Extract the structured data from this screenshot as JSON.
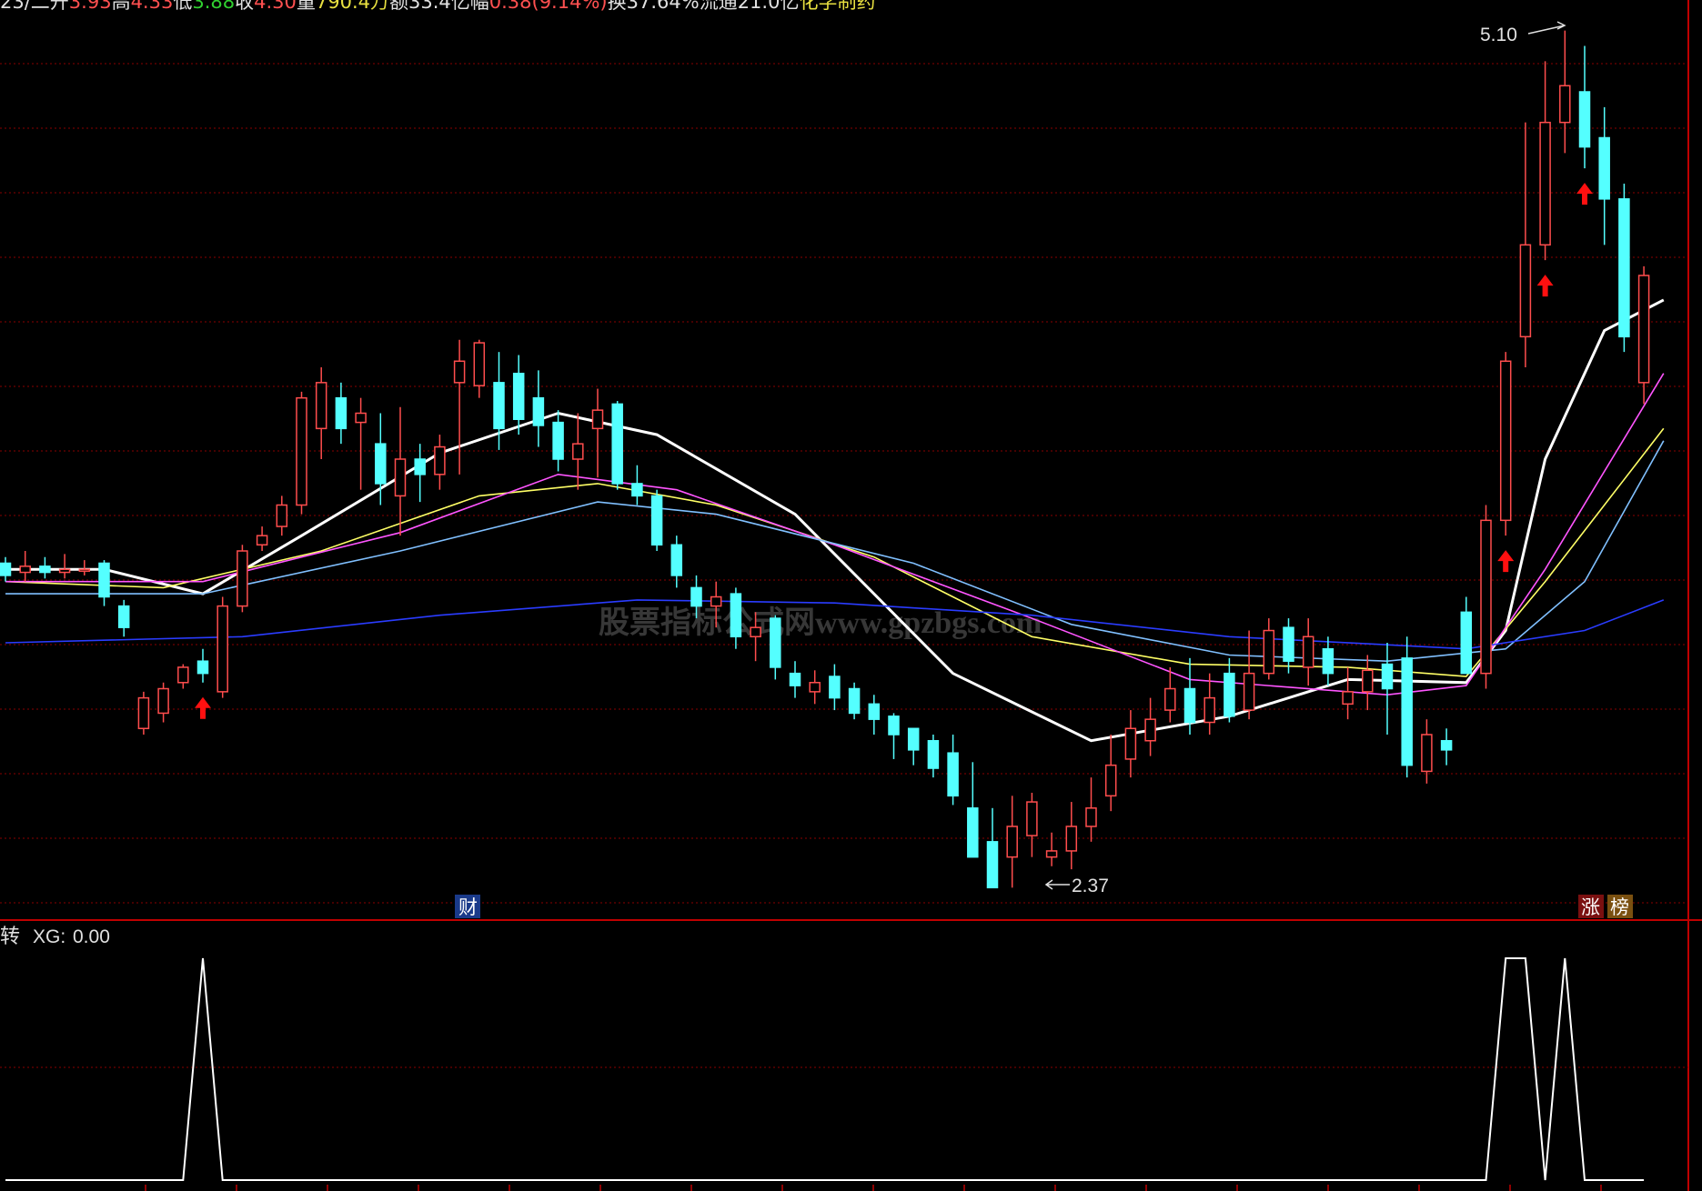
{
  "header": {
    "items": [
      {
        "text": "23/二",
        "color": "#e0e0e0"
      },
      {
        "text": "开",
        "color": "#e0e0e0"
      },
      {
        "text": "3.93",
        "color": "#ff5050"
      },
      {
        "text": "高",
        "color": "#e0e0e0"
      },
      {
        "text": "4.33",
        "color": "#ff5050"
      },
      {
        "text": "低",
        "color": "#e0e0e0"
      },
      {
        "text": "3.88",
        "color": "#30d030"
      },
      {
        "text": "收",
        "color": "#e0e0e0"
      },
      {
        "text": "4.30",
        "color": "#ff5050"
      },
      {
        "text": "量",
        "color": "#e0e0e0"
      },
      {
        "text": "790.4万",
        "color": "#e8e040"
      },
      {
        "text": "额",
        "color": "#e0e0e0"
      },
      {
        "text": "33.4亿",
        "color": "#e0e0e0"
      },
      {
        "text": "幅",
        "color": "#e0e0e0"
      },
      {
        "text": "0.38(9.14%)",
        "color": "#ff5050"
      },
      {
        "text": "换",
        "color": "#e0e0e0"
      },
      {
        "text": "37.64%",
        "color": "#e0e0e0"
      },
      {
        "text": "流通",
        "color": "#e0e0e0"
      },
      {
        "text": "21.0亿",
        "color": "#e0e0e0"
      },
      {
        "text": "化学制药",
        "color": "#e8e040"
      }
    ]
  },
  "badges": {
    "cai": "财",
    "zhang": "涨",
    "bang": "榜"
  },
  "indicator": {
    "name": "转",
    "label": "XG:",
    "value": "0.00"
  },
  "watermark": "股票指标公式网www.gpzbgs.com",
  "colors": {
    "up": "#ff4d4d",
    "down": "#54ffff",
    "grid": "#8a0000",
    "border": "#c00000",
    "ma5": "#ffffff",
    "ma10": "#ffff66",
    "ma20": "#ff55ff",
    "ma30": "#80c0ff",
    "ma60": "#2a3cff",
    "arrow": "#ff1010"
  },
  "chart_data": {
    "type": "candlestick",
    "price_range": [
      2.2,
      5.2
    ],
    "annotations": [
      {
        "text": "5.10",
        "index": 79,
        "value": 5.1
      },
      {
        "text": "2.37",
        "index": 53,
        "value": 2.37
      }
    ],
    "candles": [
      [
        3.36,
        3.32,
        3.38,
        3.3
      ],
      [
        3.33,
        3.35,
        3.4,
        3.3
      ],
      [
        3.35,
        3.33,
        3.38,
        3.31
      ],
      [
        3.33,
        3.34,
        3.39,
        3.31
      ],
      [
        3.34,
        3.34,
        3.37,
        3.32
      ],
      [
        3.36,
        3.25,
        3.37,
        3.22
      ],
      [
        3.22,
        3.15,
        3.24,
        3.12
      ],
      [
        2.82,
        2.92,
        2.94,
        2.8
      ],
      [
        2.87,
        2.95,
        2.97,
        2.84
      ],
      [
        2.97,
        3.02,
        3.03,
        2.95
      ],
      [
        3.04,
        3.0,
        3.08,
        2.97
      ],
      [
        2.94,
        3.22,
        3.25,
        2.92
      ],
      [
        3.22,
        3.4,
        3.42,
        3.2
      ],
      [
        3.42,
        3.45,
        3.48,
        3.4
      ],
      [
        3.48,
        3.55,
        3.58,
        3.45
      ],
      [
        3.55,
        3.9,
        3.92,
        3.52
      ],
      [
        3.8,
        3.95,
        4.0,
        3.7
      ],
      [
        3.9,
        3.8,
        3.95,
        3.75
      ],
      [
        3.82,
        3.85,
        3.9,
        3.6
      ],
      [
        3.75,
        3.62,
        3.85,
        3.55
      ],
      [
        3.58,
        3.7,
        3.87,
        3.45
      ],
      [
        3.7,
        3.65,
        3.75,
        3.56
      ],
      [
        3.65,
        3.74,
        3.78,
        3.6
      ],
      [
        3.95,
        4.02,
        4.09,
        3.65
      ],
      [
        3.94,
        4.08,
        4.09,
        3.9
      ],
      [
        3.95,
        3.8,
        4.05,
        3.73
      ],
      [
        3.98,
        3.83,
        4.04,
        3.78
      ],
      [
        3.9,
        3.81,
        3.99,
        3.74
      ],
      [
        3.82,
        3.7,
        3.86,
        3.66
      ],
      [
        3.7,
        3.75,
        3.85,
        3.6
      ],
      [
        3.8,
        3.86,
        3.93,
        3.64
      ],
      [
        3.88,
        3.62,
        3.89,
        3.6
      ],
      [
        3.62,
        3.58,
        3.68,
        3.55
      ],
      [
        3.58,
        3.42,
        3.6,
        3.4
      ],
      [
        3.42,
        3.32,
        3.45,
        3.28
      ],
      [
        3.28,
        3.22,
        3.32,
        3.18
      ],
      [
        3.22,
        3.25,
        3.3,
        3.15
      ],
      [
        3.26,
        3.12,
        3.28,
        3.08
      ],
      [
        3.12,
        3.15,
        3.2,
        3.04
      ],
      [
        3.18,
        3.02,
        3.19,
        2.98
      ],
      [
        3.0,
        2.96,
        3.04,
        2.92
      ],
      [
        2.94,
        2.97,
        3.01,
        2.9
      ],
      [
        2.99,
        2.92,
        3.03,
        2.88
      ],
      [
        2.95,
        2.87,
        2.97,
        2.85
      ],
      [
        2.9,
        2.85,
        2.93,
        2.8
      ],
      [
        2.86,
        2.8,
        2.87,
        2.72
      ],
      [
        2.82,
        2.75,
        2.82,
        2.7
      ],
      [
        2.78,
        2.69,
        2.8,
        2.66
      ],
      [
        2.74,
        2.6,
        2.8,
        2.57
      ],
      [
        2.56,
        2.4,
        2.71,
        2.44
      ],
      [
        2.45,
        2.3,
        2.56,
        2.36
      ],
      [
        2.4,
        2.5,
        2.6,
        2.3
      ],
      [
        2.47,
        2.58,
        2.61,
        2.4
      ],
      [
        2.4,
        2.42,
        2.48,
        2.37
      ],
      [
        2.42,
        2.5,
        2.58,
        2.36
      ],
      [
        2.5,
        2.56,
        2.66,
        2.45
      ],
      [
        2.6,
        2.7,
        2.8,
        2.55
      ],
      [
        2.72,
        2.82,
        2.88,
        2.66
      ],
      [
        2.78,
        2.85,
        2.92,
        2.73
      ],
      [
        2.88,
        2.95,
        3.02,
        2.84
      ],
      [
        2.95,
        2.84,
        3.05,
        2.8
      ],
      [
        2.84,
        2.92,
        3.0,
        2.8
      ],
      [
        3.0,
        2.86,
        3.05,
        2.84
      ],
      [
        2.88,
        3.0,
        3.14,
        2.85
      ],
      [
        3.0,
        3.14,
        3.18,
        2.98
      ],
      [
        3.15,
        3.04,
        3.18,
        3.0
      ],
      [
        3.02,
        3.12,
        3.18,
        2.96
      ],
      [
        3.08,
        3.0,
        3.12,
        2.96
      ],
      [
        2.9,
        2.94,
        3.02,
        2.85
      ],
      [
        2.94,
        3.01,
        3.06,
        2.88
      ],
      [
        3.03,
        2.95,
        3.1,
        2.8
      ],
      [
        3.05,
        2.7,
        3.12,
        2.66
      ],
      [
        2.68,
        2.8,
        2.85,
        2.64
      ],
      [
        2.78,
        2.75,
        2.82,
        2.7
      ],
      [
        3.2,
        3.0,
        3.25,
        3.0
      ],
      [
        3.0,
        3.5,
        3.55,
        2.95
      ],
      [
        3.5,
        4.02,
        4.05,
        3.45
      ],
      [
        4.1,
        4.4,
        4.8,
        4.0
      ],
      [
        4.4,
        4.8,
        5.0,
        4.35
      ],
      [
        4.8,
        4.92,
        5.1,
        4.7
      ],
      [
        4.9,
        4.72,
        5.05,
        4.65
      ],
      [
        4.75,
        4.55,
        4.85,
        4.4
      ],
      [
        4.55,
        4.1,
        4.6,
        4.05
      ],
      [
        3.95,
        4.3,
        4.33,
        3.88
      ]
    ],
    "series": [
      {
        "name": "",
        "color_key": "ma5",
        "values": [
          [
            0,
            3.34
          ],
          [
            5,
            3.34
          ],
          [
            10,
            3.26
          ],
          [
            15,
            3.45
          ],
          [
            22,
            3.72
          ],
          [
            28,
            3.85
          ],
          [
            33,
            3.78
          ],
          [
            40,
            3.52
          ],
          [
            48,
            3.0
          ],
          [
            55,
            2.78
          ],
          [
            62,
            2.86
          ],
          [
            68,
            2.98
          ],
          [
            74,
            2.97
          ],
          [
            76,
            3.14
          ],
          [
            78,
            3.7
          ],
          [
            81,
            4.12
          ],
          [
            84,
            4.22
          ]
        ]
      },
      {
        "name": "",
        "color_key": "ma10",
        "values": [
          [
            0,
            3.3
          ],
          [
            8,
            3.28
          ],
          [
            16,
            3.4
          ],
          [
            24,
            3.58
          ],
          [
            30,
            3.62
          ],
          [
            36,
            3.55
          ],
          [
            44,
            3.38
          ],
          [
            52,
            3.12
          ],
          [
            60,
            3.03
          ],
          [
            68,
            3.02
          ],
          [
            74,
            2.99
          ],
          [
            78,
            3.3
          ],
          [
            84,
            3.8
          ]
        ]
      },
      {
        "name": "",
        "color_key": "ma20",
        "values": [
          [
            0,
            3.3
          ],
          [
            10,
            3.3
          ],
          [
            20,
            3.46
          ],
          [
            28,
            3.65
          ],
          [
            34,
            3.6
          ],
          [
            42,
            3.42
          ],
          [
            52,
            3.18
          ],
          [
            60,
            2.98
          ],
          [
            70,
            2.93
          ],
          [
            74,
            2.96
          ],
          [
            78,
            3.34
          ],
          [
            84,
            3.98
          ]
        ]
      },
      {
        "name": "",
        "color_key": "ma30",
        "values": [
          [
            0,
            3.26
          ],
          [
            10,
            3.26
          ],
          [
            20,
            3.4
          ],
          [
            30,
            3.56
          ],
          [
            36,
            3.52
          ],
          [
            46,
            3.36
          ],
          [
            54,
            3.16
          ],
          [
            62,
            3.06
          ],
          [
            70,
            3.04
          ],
          [
            76,
            3.08
          ],
          [
            80,
            3.3
          ],
          [
            84,
            3.76
          ]
        ]
      },
      {
        "name": "",
        "color_key": "ma60",
        "values": [
          [
            0,
            3.1
          ],
          [
            12,
            3.12
          ],
          [
            22,
            3.19
          ],
          [
            32,
            3.24
          ],
          [
            42,
            3.23
          ],
          [
            52,
            3.19
          ],
          [
            62,
            3.12
          ],
          [
            74,
            3.08
          ],
          [
            80,
            3.14
          ],
          [
            84,
            3.24
          ]
        ]
      }
    ],
    "signals": [
      10,
      76,
      78,
      80
    ],
    "indicator_series": {
      "name": "XG",
      "signal_days": [
        10,
        76,
        77,
        79
      ],
      "range": [
        0,
        1
      ]
    }
  }
}
